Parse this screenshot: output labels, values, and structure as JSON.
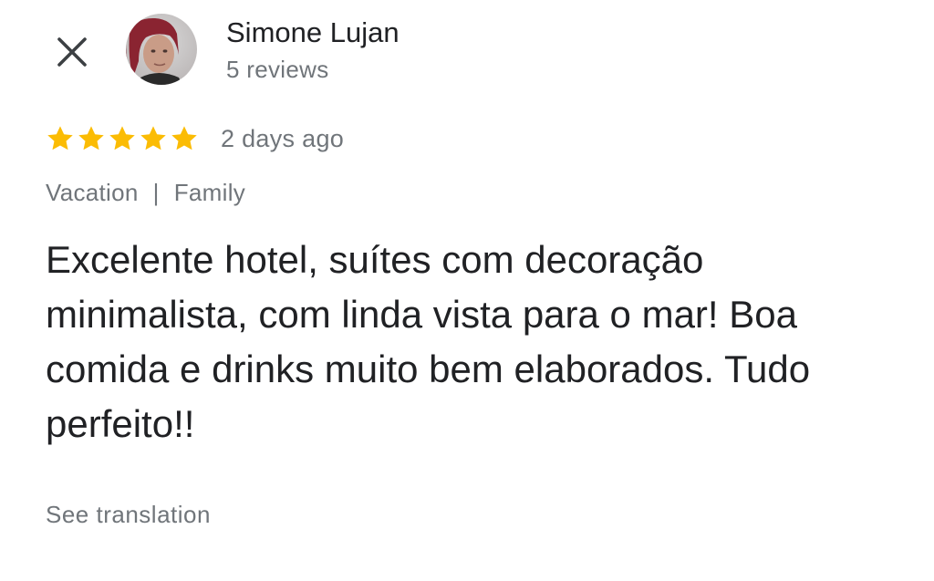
{
  "header": {
    "close_icon": "close-icon",
    "author_name": "Simone Lujan",
    "author_reviews": "5 reviews"
  },
  "review": {
    "rating": 5,
    "rating_max": 5,
    "star_color": "#fbbc04",
    "date": "2 days ago",
    "tags": [
      "Vacation",
      "Family"
    ],
    "tag_separator": "|",
    "text": "Excelente hotel, suítes com decoração minimalista, com linda vista para o mar! Boa comida e drinks muito bem elaborados. Tudo perfeito!!",
    "see_translation": "See translation"
  },
  "colors": {
    "primary_text": "#202124",
    "secondary_text": "#70757a"
  }
}
